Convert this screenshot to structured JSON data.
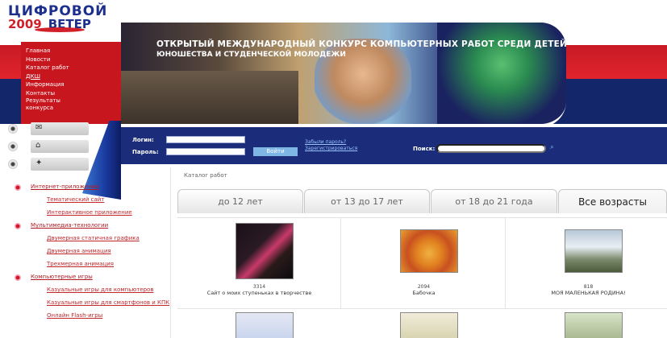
{
  "logo": {
    "line1": "ЦИФРОВОЙ",
    "year": "2009",
    "line2": "ВЕТЕР"
  },
  "nav": [
    "Главная",
    "Новости",
    "Каталог работ",
    "ДКШ",
    "Информация",
    "Контакты",
    "Результаты конкурса"
  ],
  "banner": {
    "title_line1": "ОТКРЫТЫЙ МЕЖДУНАРОДНЫЙ КОНКУРС КОМПЬЮТЕРНЫХ РАБОТ СРЕДИ ДЕТЕЙ,",
    "title_line2": "ЮНОШЕСТВА И СТУДЕНЧЕСКОЙ МОЛОДЕЖИ"
  },
  "login": {
    "login_label": "Логин:",
    "password_label": "Пароль:",
    "enter_button": "Войти",
    "forgot_link": "Забыли пароль?",
    "register_link": "Зарегистрироваться",
    "search_label": "Поиск:",
    "search_icon": "⌕"
  },
  "left_icons": [
    {
      "name": "mail-icon",
      "glyph": "✉"
    },
    {
      "name": "home-icon",
      "glyph": "⌂"
    },
    {
      "name": "sitemap-icon",
      "glyph": "✦"
    }
  ],
  "categories": [
    {
      "label": "Интернет-приложения",
      "children": [
        "Тематический сайт",
        "Интерактивное приложение"
      ]
    },
    {
      "label": "Мультимедиа-технологии",
      "children": [
        "Двумерная статичная графика",
        "Двумерная анимация",
        "Трехмерная анимация"
      ]
    },
    {
      "label": "Компьютерные игры",
      "children": [
        "Казуальные игры для компьютеров",
        "Казуальные игры для смартфонов и КПК",
        "Онлайн Flash-игры"
      ]
    }
  ],
  "breadcrumb": "Каталог работ",
  "tabs": [
    "до 12 лет",
    "от 13 до 17 лет",
    "от 18 до 21 года",
    "Все возрасты"
  ],
  "active_tab": "Все возрасты",
  "works": [
    {
      "count": "3314",
      "title": "Сайт о моих ступеньках в творчестве"
    },
    {
      "count": "2094",
      "title": "Бабочка"
    },
    {
      "count": "818",
      "title": "МОЯ МАЛЕНЬКАЯ РОДИНА!"
    }
  ],
  "colors": {
    "brand_red": "#c8161f",
    "navy": "#13266a",
    "link": "#b01a20"
  }
}
